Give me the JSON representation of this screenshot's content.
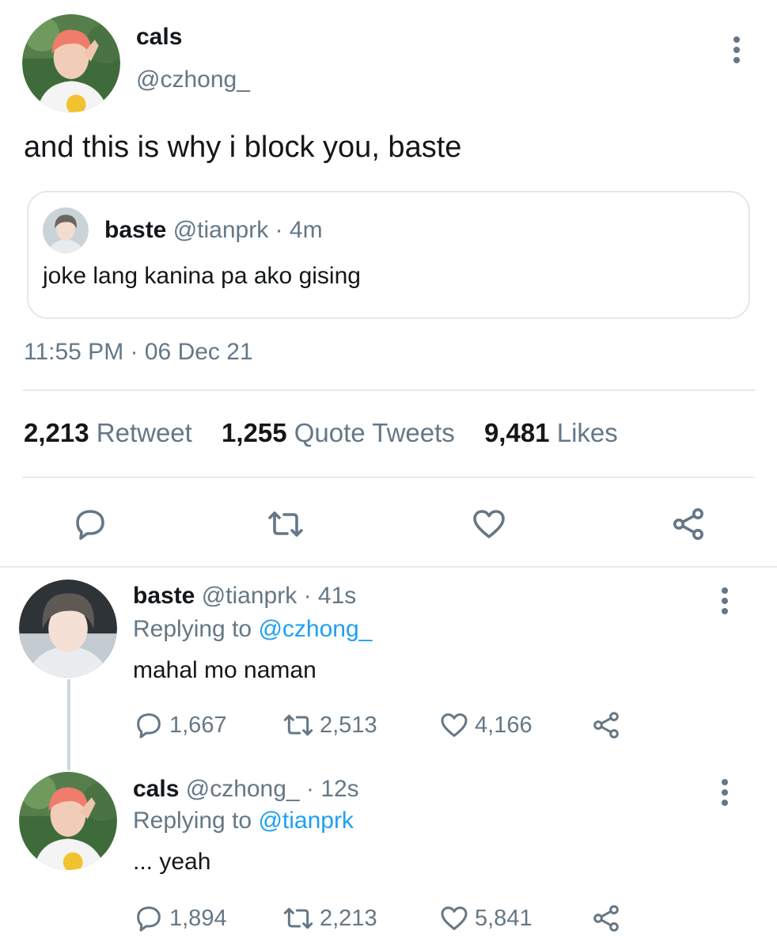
{
  "main_tweet": {
    "display_name": "cals",
    "handle": "@czhong_",
    "text": "and this is why i block you, baste",
    "quoted": {
      "display_name": "baste",
      "handle": "@tianprk",
      "separator": "·",
      "time": "4m",
      "text": "joke lang kanina pa ako gising"
    },
    "time": "11:55 PM",
    "separator": "·",
    "date": "06 Dec 21",
    "stats": {
      "retweets": "2,213",
      "retweets_label": "Retweet",
      "quotes": "1,255",
      "quotes_label": "Quote Tweets",
      "likes": "9,481",
      "likes_label": "Likes"
    }
  },
  "replies": [
    {
      "display_name": "baste",
      "handle": "@tianprk",
      "separator": "·",
      "time": "41s",
      "replying_label": "Replying to",
      "replying_handle": "@czhong_",
      "text": "mahal mo naman",
      "replies": "1,667",
      "retweets": "2,513",
      "likes": "4,166"
    },
    {
      "display_name": "cals",
      "handle": "@czhong_",
      "separator": "·",
      "time": "12s",
      "replying_label": "Replying to",
      "replying_handle": "@tianprk",
      "text": "... yeah",
      "replies": "1,894",
      "retweets": "2,213",
      "likes": "5,841"
    }
  ],
  "colors": {
    "text": "#14171a",
    "secondary": "#657786",
    "link": "#1da1f2",
    "border": "#e1e8ed"
  },
  "icons": [
    "more-vertical-icon",
    "reply-icon",
    "retweet-icon",
    "like-icon",
    "share-icon"
  ]
}
